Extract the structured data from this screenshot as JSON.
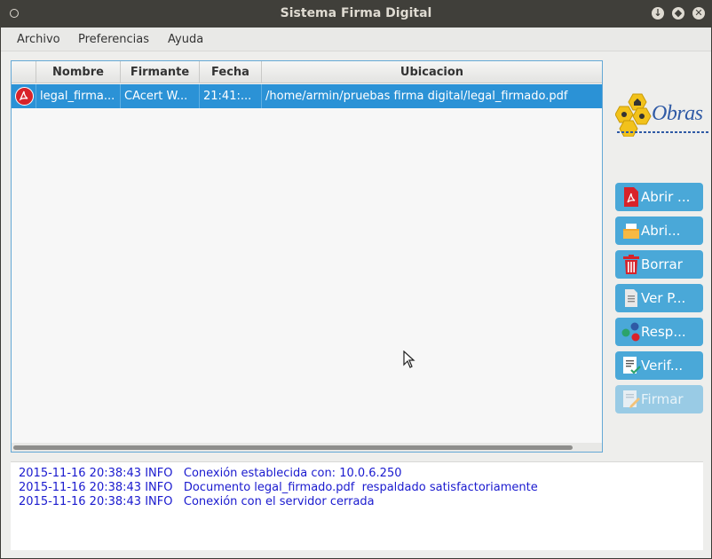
{
  "window": {
    "title": "Sistema Firma Digital"
  },
  "menu": {
    "items": [
      "Archivo",
      "Preferencias",
      "Ayuda"
    ]
  },
  "table": {
    "columns": [
      "Nombre",
      "Firmante",
      "Fecha",
      "Ubicacion"
    ],
    "rows": [
      {
        "icon": "pdf-icon",
        "nombre": "legal_firma...",
        "firmante": "CAcert W...",
        "fecha": "21:41:...",
        "ubicacion": "/home/armin/pruebas firma digital/legal_firmado.pdf"
      }
    ]
  },
  "logo": {
    "text": "Obras"
  },
  "actions": [
    {
      "label": "Abrir ...",
      "icon": "pdf-file-icon",
      "enabled": true
    },
    {
      "label": "Abri...",
      "icon": "folder-icon",
      "enabled": true
    },
    {
      "label": "Borrar",
      "icon": "trash-icon",
      "enabled": true
    },
    {
      "label": "Ver P...",
      "icon": "document-icon",
      "enabled": true
    },
    {
      "label": "Resp...",
      "icon": "share-icon",
      "enabled": true
    },
    {
      "label": "Verif...",
      "icon": "verify-checklist-icon",
      "enabled": true
    },
    {
      "label": "Firmar",
      "icon": "sign-pen-icon",
      "enabled": false
    }
  ],
  "log": {
    "lines": [
      "2015-11-16 20:38:43 INFO   Conexión establecida con: 10.0.6.250",
      "2015-11-16 20:38:43 INFO   Documento legal_firmado.pdf  respaldado satisfactoriamente",
      "2015-11-16 20:38:43 INFO   Conexión con el servidor cerrada"
    ]
  },
  "colors": {
    "selection": "#2b92d6",
    "button": "#4aa8d8",
    "log_text": "#1a1acf"
  }
}
